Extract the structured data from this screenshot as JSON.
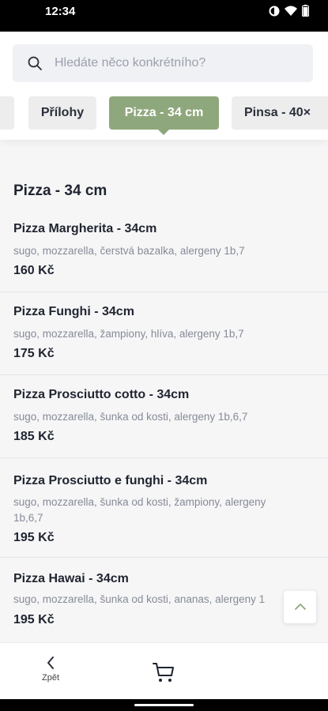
{
  "status_bar": {
    "time": "12:34"
  },
  "search": {
    "placeholder": "Hledáte něco konkrétního?"
  },
  "tabs": [
    {
      "label": "Přílohy"
    },
    {
      "label": "Pizza - 34 cm"
    },
    {
      "label": "Pinsa - 40×"
    }
  ],
  "active_tab_index": 1,
  "section": {
    "title": "Pizza - 34 cm"
  },
  "items": [
    {
      "name": "Pizza Margherita - 34cm",
      "description": "sugo, mozzarella, čerstvá bazalka, alergeny 1b,7",
      "price": "160 Kč"
    },
    {
      "name": "Pizza Funghi - 34cm",
      "description": "sugo, mozzarella, žampiony, hlíva, alergeny 1b,7",
      "price": "175 Kč"
    },
    {
      "name": "Pizza Prosciutto cotto - 34cm",
      "description": "sugo, mozzarella, šunka od kosti, alergeny 1b,6,7",
      "price": "185 Kč"
    },
    {
      "name": "Pizza Prosciutto e funghi - 34cm",
      "description": "sugo, mozzarella, šunka od kosti, žampiony, alergeny 1b,6,7",
      "price": "195 Kč"
    },
    {
      "name": "Pizza Hawai - 34cm",
      "description": "sugo, mozzarella, šunka od kosti, ananas, alergeny 1",
      "price": "195 Kč"
    }
  ],
  "bottom_nav": {
    "back_label": "Zpět"
  },
  "colors": {
    "accent": "#8fa77c",
    "text": "#1f2430",
    "muted": "#868b97"
  }
}
